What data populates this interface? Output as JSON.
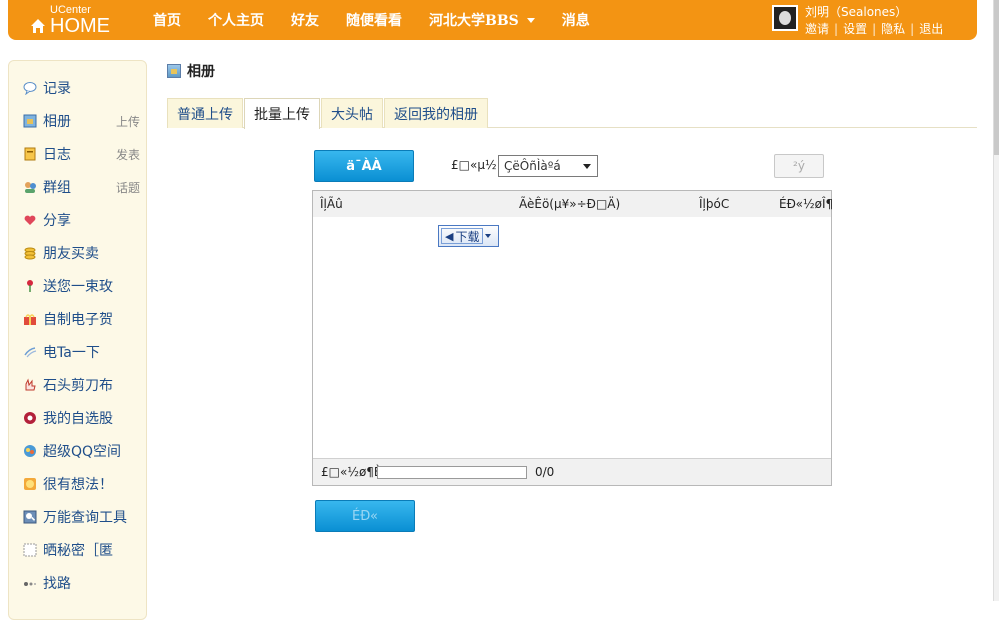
{
  "brand": {
    "top": "UCenter",
    "main": "HOME"
  },
  "nav": [
    {
      "label": "首页"
    },
    {
      "label": "个人主页"
    },
    {
      "label": "好友"
    },
    {
      "label": "随便看看"
    },
    {
      "label": "河北大学BBS",
      "dropdown": true
    },
    {
      "label": "消息"
    }
  ],
  "user": {
    "name": "刘明（Sealones）",
    "links": [
      "邀请",
      "设置",
      "隐私",
      "退出"
    ]
  },
  "sidebar": {
    "items": [
      {
        "label": "记录",
        "icon": "speech-bubble-icon"
      },
      {
        "label": "相册",
        "extra": "上传",
        "icon": "album-icon"
      },
      {
        "label": "日志",
        "extra": "发表",
        "icon": "notebook-icon"
      },
      {
        "label": "群组",
        "extra": "话题",
        "icon": "group-icon"
      },
      {
        "label": "分享",
        "icon": "hearts-icon"
      },
      {
        "label": "朋友买卖",
        "icon": "coins-icon"
      },
      {
        "label": "送您一束玫",
        "icon": "rose-icon"
      },
      {
        "label": "自制电子贺",
        "icon": "gift-icon"
      },
      {
        "label": "电Ta一下",
        "icon": "lightning-icon"
      },
      {
        "label": "石头剪刀布",
        "icon": "hand-icon"
      },
      {
        "label": "我的自选股",
        "icon": "stock-icon"
      },
      {
        "label": "超级QQ空间",
        "icon": "qq-icon"
      },
      {
        "label": "很有想法！",
        "icon": "smiley-icon"
      },
      {
        "label": "万能查询工具",
        "icon": "search-tool-icon"
      },
      {
        "label": "晒秘密［匿",
        "icon": "secret-icon"
      },
      {
        "label": "找路",
        "icon": "path-icon"
      }
    ]
  },
  "page": {
    "title": "相册"
  },
  "tabs": [
    {
      "label": "普通上传",
      "active": false
    },
    {
      "label": "批量上传",
      "active": true
    },
    {
      "label": "大头帖",
      "active": false
    },
    {
      "label": "返回我的相册",
      "active": false
    }
  ],
  "uploader": {
    "browse_label": "ä¯ÀÀ",
    "album_label": "£□«µ½:",
    "album_select": "ÇëÔñÌàºá",
    "clear_label": "²ý",
    "columns": [
      "ÎļÃû",
      "ÃèÊö(µ¥»÷Ð□Ä)",
      "ÎļþóC",
      "ÉÐ«½øÎ¶"
    ],
    "download_label": "下载",
    "footer_label": "£□«½ø¶È",
    "progress_percent": 0,
    "count": "0/0",
    "submit_label": "ÉÐ«"
  }
}
